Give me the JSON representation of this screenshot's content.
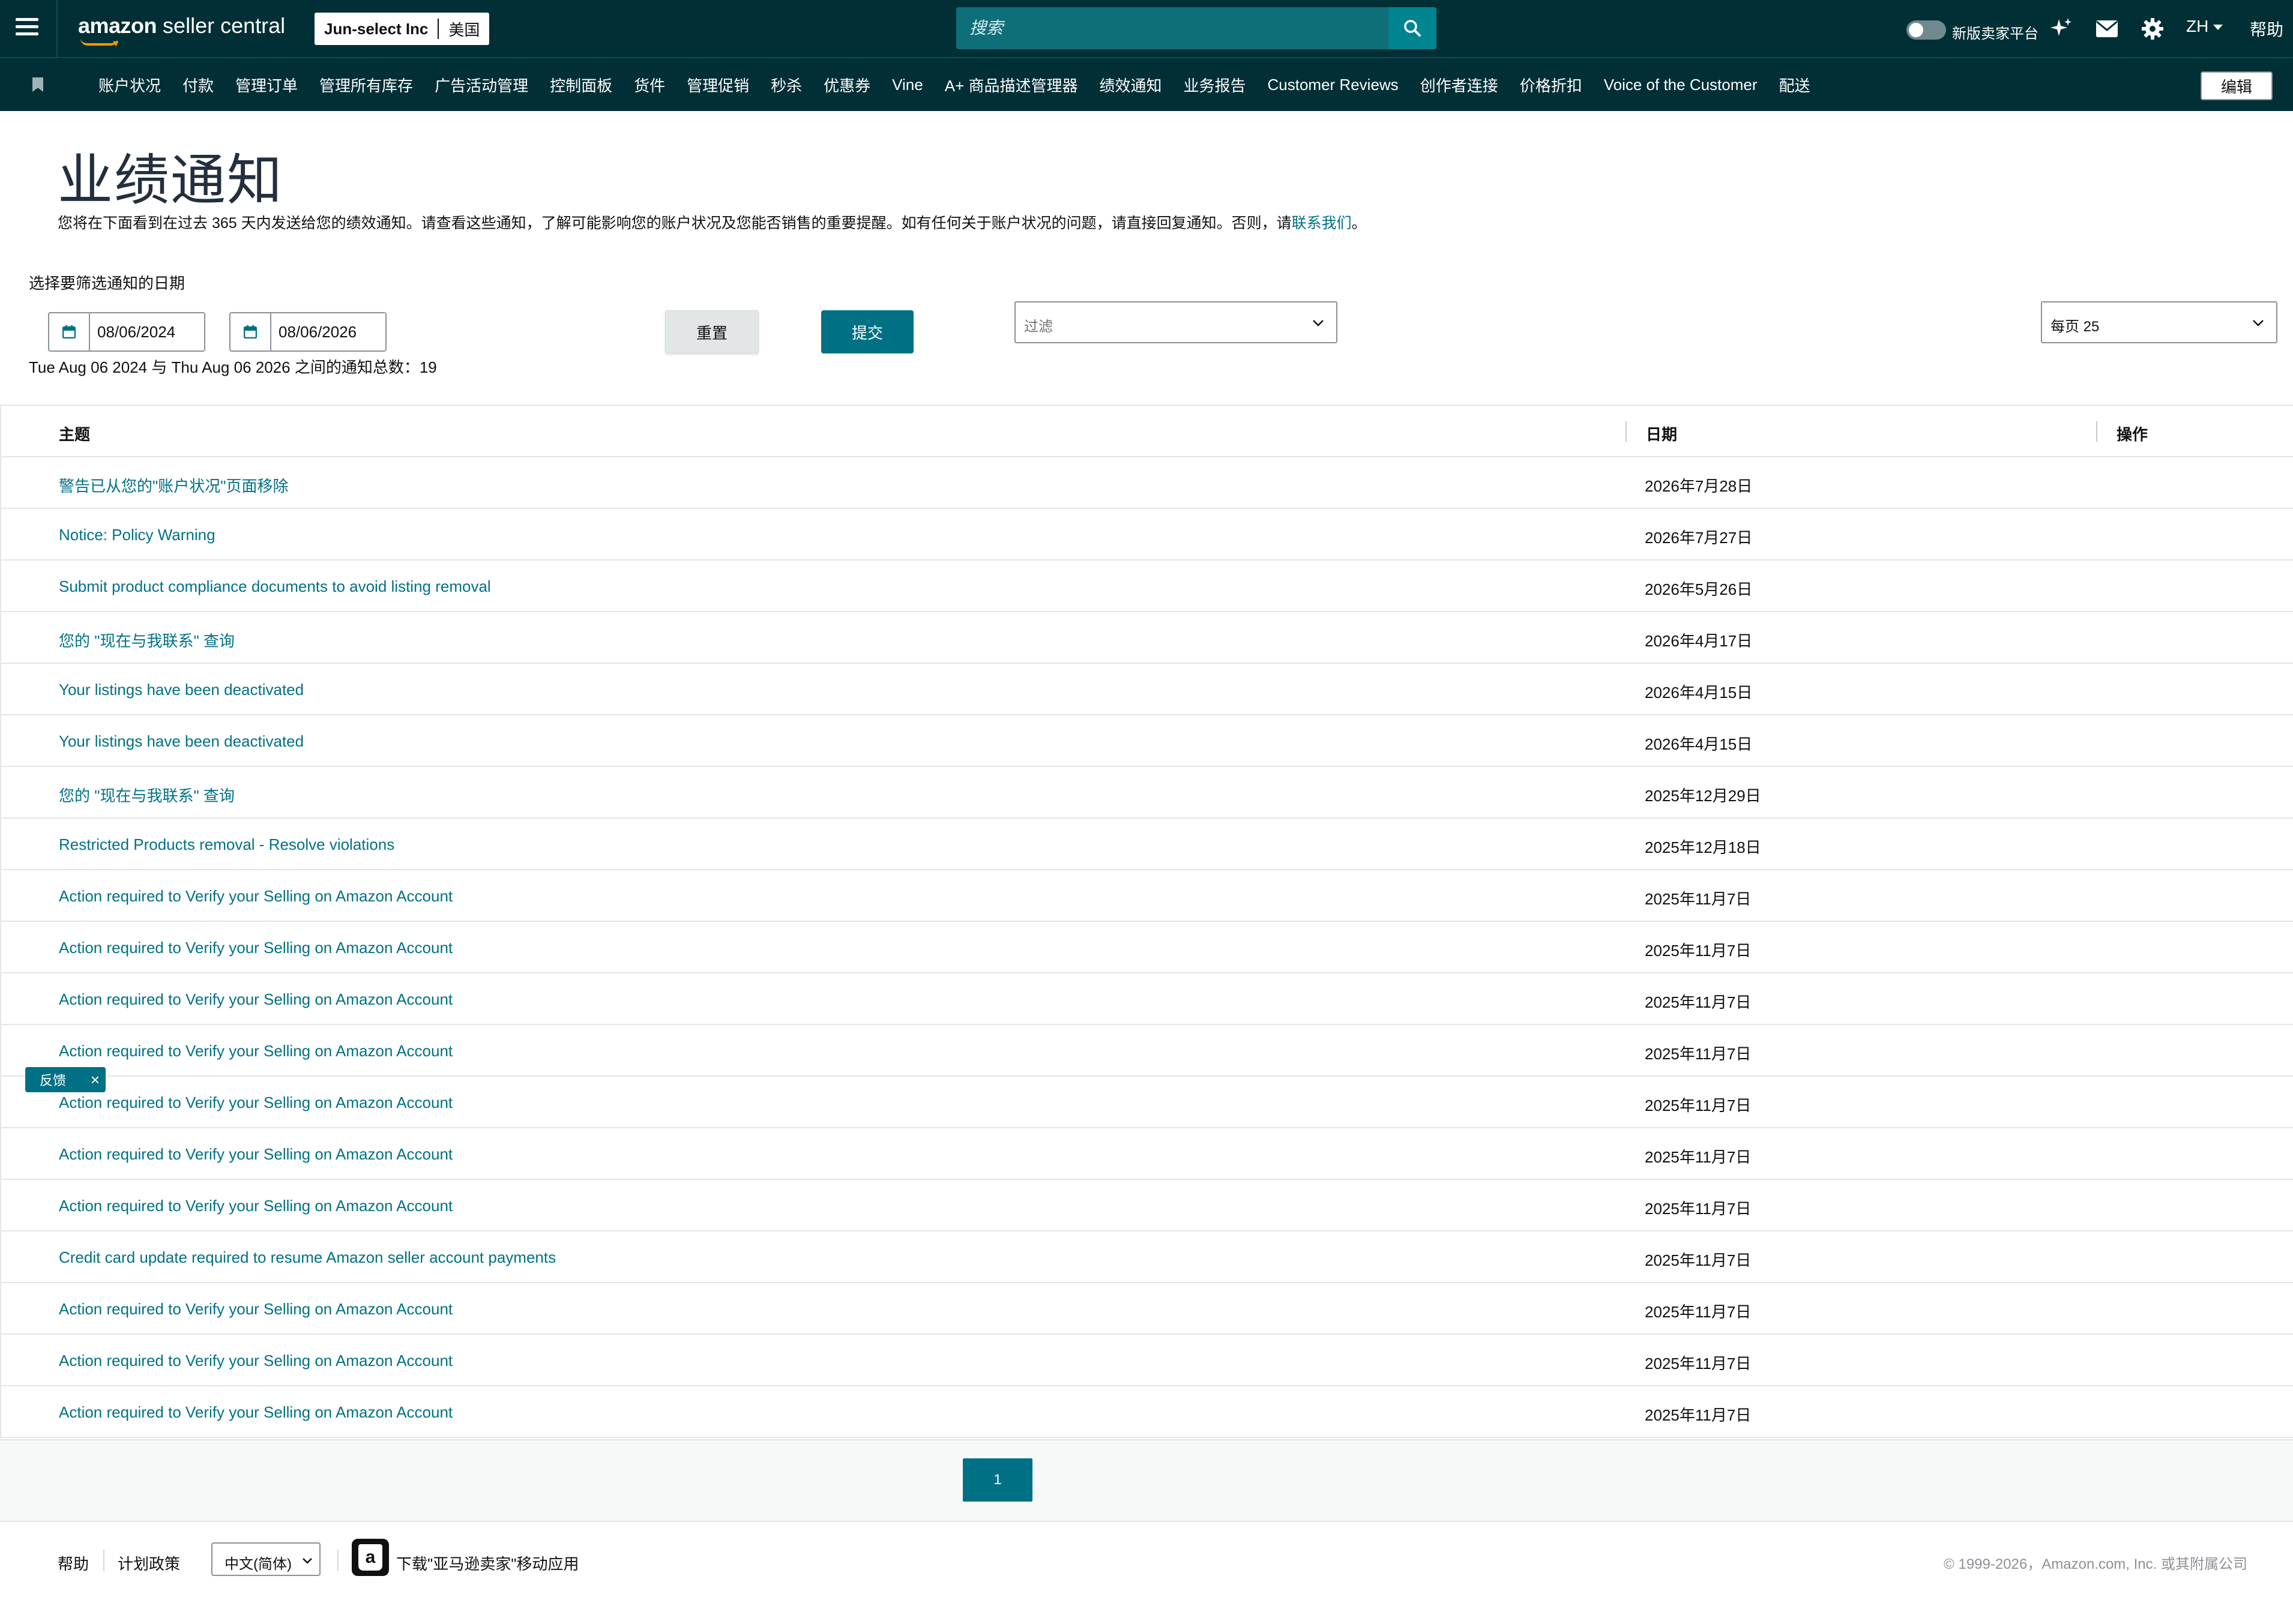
{
  "header": {
    "logo_brand": "amazon",
    "logo_product": "seller central",
    "account_name": "Jun-select Inc",
    "account_region": "美国",
    "search_placeholder": "搜索",
    "new_platform_label": "新版卖家平台",
    "language": "ZH",
    "help": "帮助",
    "icons": [
      "menu-icon",
      "search-icon",
      "sparkle-icon",
      "mail-icon",
      "gear-icon"
    ]
  },
  "nav": {
    "items": [
      "账户状况",
      "付款",
      "管理订单",
      "管理所有库存",
      "广告活动管理",
      "控制面板",
      "货件",
      "管理促销",
      "秒杀",
      "优惠券",
      "Vine",
      "A+ 商品描述管理器",
      "绩效通知",
      "业务报告",
      "Customer Reviews",
      "创作者连接",
      "价格折扣",
      "Voice of the Customer",
      "配送"
    ],
    "edit_label": "编辑"
  },
  "page": {
    "title": "业绩通知",
    "description": "您将在下面看到在过去 365 天内发送给您的绩效通知。请查看这些通知，了解可能影响您的账户状况及您能否销售的重要提醒。如有任何关于账户状况的问题，请直接回复通知。否则，请",
    "contact_link": "联系我们",
    "description_end": "。"
  },
  "filters": {
    "label": "选择要筛选通知的日期",
    "start_date": "08/06/2024",
    "end_date": "08/06/2026",
    "reset_label": "重置",
    "submit_label": "提交",
    "filter_placeholder": "过滤",
    "per_page": "每页 25",
    "summary": "Tue Aug 06 2024 与 Thu Aug 06 2026 之间的通知总数：19"
  },
  "table": {
    "columns": [
      "主题",
      "日期",
      "操作"
    ],
    "rows": [
      {
        "subject": "警告已从您的\"账户状况\"页面移除",
        "date": "2026年7月28日"
      },
      {
        "subject": "Notice: Policy Warning",
        "date": "2026年7月27日"
      },
      {
        "subject": "Submit product compliance documents to avoid listing removal",
        "date": "2026年5月26日"
      },
      {
        "subject": "您的 \"现在与我联系\" 查询",
        "date": "2026年4月17日"
      },
      {
        "subject": "Your listings have been deactivated",
        "date": "2026年4月15日"
      },
      {
        "subject": "Your listings have been deactivated",
        "date": "2026年4月15日"
      },
      {
        "subject": "您的 \"现在与我联系\" 查询",
        "date": "2025年12月29日"
      },
      {
        "subject": "Restricted Products removal - Resolve violations",
        "date": "2025年12月18日"
      },
      {
        "subject": "Action required to Verify your Selling on Amazon Account",
        "date": "2025年11月7日"
      },
      {
        "subject": "Action required to Verify your Selling on Amazon Account",
        "date": "2025年11月7日"
      },
      {
        "subject": "Action required to Verify your Selling on Amazon Account",
        "date": "2025年11月7日"
      },
      {
        "subject": "Action required to Verify your Selling on Amazon Account",
        "date": "2025年11月7日"
      },
      {
        "subject": "Action required to Verify your Selling on Amazon Account",
        "date": "2025年11月7日"
      },
      {
        "subject": "Action required to Verify your Selling on Amazon Account",
        "date": "2025年11月7日"
      },
      {
        "subject": "Action required to Verify your Selling on Amazon Account",
        "date": "2025年11月7日"
      },
      {
        "subject": "Credit card update required to resume Amazon seller account payments",
        "date": "2025年11月7日"
      },
      {
        "subject": "Action required to Verify your Selling on Amazon Account",
        "date": "2025年11月7日"
      },
      {
        "subject": "Action required to Verify your Selling on Amazon Account",
        "date": "2025年11月7日"
      },
      {
        "subject": "Action required to Verify your Selling on Amazon Account",
        "date": "2025年11月7日"
      }
    ]
  },
  "pagination": {
    "current_page": "1"
  },
  "feedback": {
    "label": "反馈",
    "close": "×"
  },
  "footer": {
    "help": "帮助",
    "program_policies": "计划政策",
    "language_select": "中文(简体)",
    "app_icon_letter": "a",
    "app_download": "下载\"亚马逊卖家\"移动应用",
    "copyright": "© 1999-2026，Amazon.com, Inc. 或其附属公司"
  },
  "colors": {
    "header_bg": "#002f36",
    "accent": "#007185",
    "search_bg": "#0e6f79",
    "logo_smile": "#ff9900"
  }
}
